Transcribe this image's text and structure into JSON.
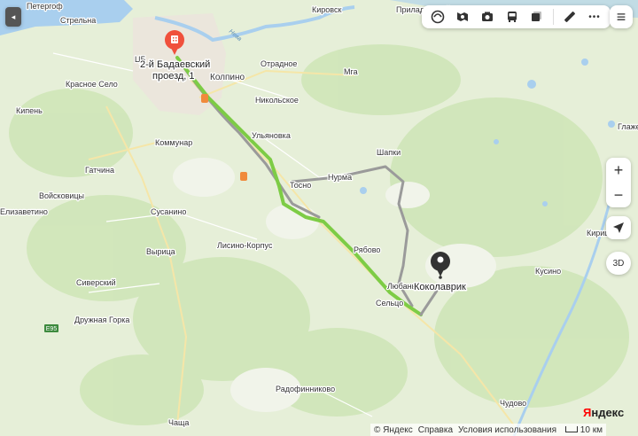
{
  "map": {
    "places": [
      {
        "name": "Петергоф"
      },
      {
        "name": "Стрельна"
      },
      {
        "name": "Кировск"
      },
      {
        "name": "Приладожский"
      },
      {
        "name": "Отрадное"
      },
      {
        "name": "Колпино"
      },
      {
        "name": "Мга"
      },
      {
        "name": "Красное Село"
      },
      {
        "name": "Кипень"
      },
      {
        "name": "Никольское"
      },
      {
        "name": "Коммунар"
      },
      {
        "name": "Ульяновка"
      },
      {
        "name": "Гатчина"
      },
      {
        "name": "Шапки"
      },
      {
        "name": "Войсковицы"
      },
      {
        "name": "Тосно"
      },
      {
        "name": "Нурма"
      },
      {
        "name": "Елизаветино"
      },
      {
        "name": "Сусанино"
      },
      {
        "name": "Лисино-Корпус"
      },
      {
        "name": "Вырица"
      },
      {
        "name": "Рябово"
      },
      {
        "name": "Сиверский"
      },
      {
        "name": "Любань"
      },
      {
        "name": "Сельцо"
      },
      {
        "name": "Кусино"
      },
      {
        "name": "Кириши"
      },
      {
        "name": "Глажево"
      },
      {
        "name": "Дружная Горка"
      },
      {
        "name": "Радофинниково"
      },
      {
        "name": "Чудово"
      },
      {
        "name": "Чаща"
      },
      {
        "name": "ЦБ"
      }
    ],
    "river_label": "Нева",
    "road_shield": "E95",
    "start_label_line1": "2-й Бадаевский",
    "start_label_line2": "проезд, 1",
    "end_label": "Коколаврик",
    "colors": {
      "route_main": "#7dcc45",
      "route_alt": "#9a9a9a",
      "start_pin": "#f0503c",
      "end_pin": "#333333",
      "water": "#a9cfee",
      "forest": "#cfe6b8"
    }
  },
  "toolbar": {
    "items": [
      {
        "icon": "traffic-icon"
      },
      {
        "icon": "panorama-icon"
      },
      {
        "icon": "camera-icon"
      },
      {
        "icon": "transport-icon"
      },
      {
        "icon": "layers-icon"
      },
      {
        "icon": "ruler-icon"
      },
      {
        "icon": "more-icon",
        "label": "•••"
      }
    ]
  },
  "controls": {
    "zoom_in": "+",
    "zoom_out": "−",
    "three_d": "3D",
    "collapse": "◂",
    "menu": "≡"
  },
  "footer": {
    "copyright": "© Яндекс",
    "help": "Справка",
    "terms": "Условия использования",
    "scale": "10 км"
  },
  "logo": {
    "brand_first": "Я",
    "brand_rest": "ндекс"
  }
}
